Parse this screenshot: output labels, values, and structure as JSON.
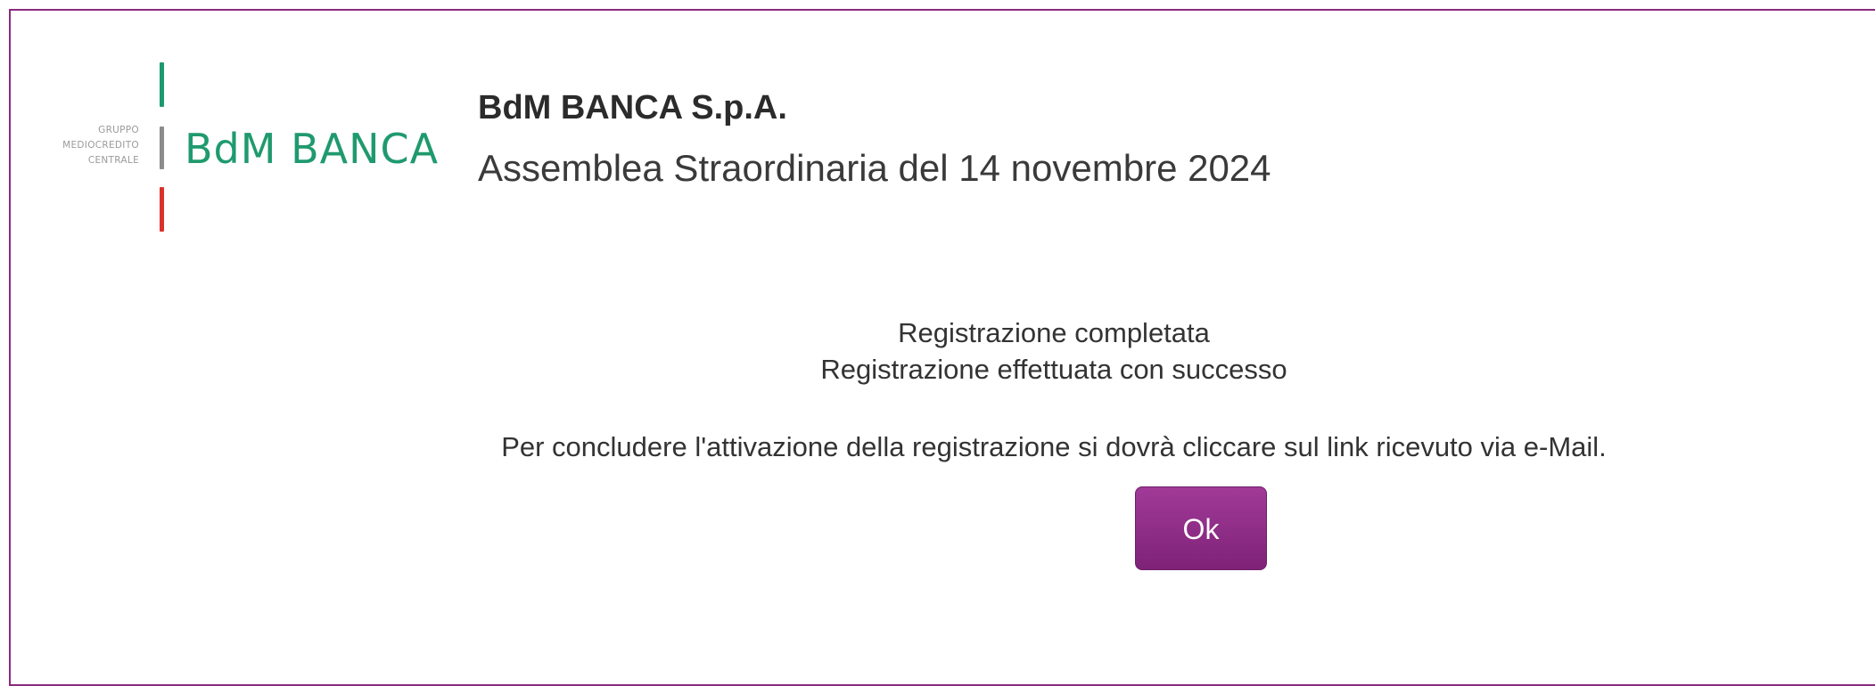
{
  "logo": {
    "group_lines": [
      "GRUPPO",
      "MEDIOCREDITO",
      "CENTRALE"
    ],
    "brand_text": "BdM BANCA",
    "colors": {
      "green": "#1f9a6e",
      "grey": "#8c8c8c",
      "red": "#d9322b",
      "brand_text": "#1f9a6e"
    }
  },
  "header": {
    "company": "BdM BANCA S.p.A.",
    "event": "Assemblea Straordinaria del 14 novembre 2024"
  },
  "message": {
    "title": "Registrazione completata",
    "subtitle": "Registrazione effettuata con successo",
    "instruction": "Per concludere l'attivazione della registrazione si dovrà cliccare sul link ricevuto via e-Mail."
  },
  "actions": {
    "ok_label": "Ok"
  },
  "theme": {
    "frame_border": "#8a2a7f",
    "button_color": "#8e2a86"
  }
}
